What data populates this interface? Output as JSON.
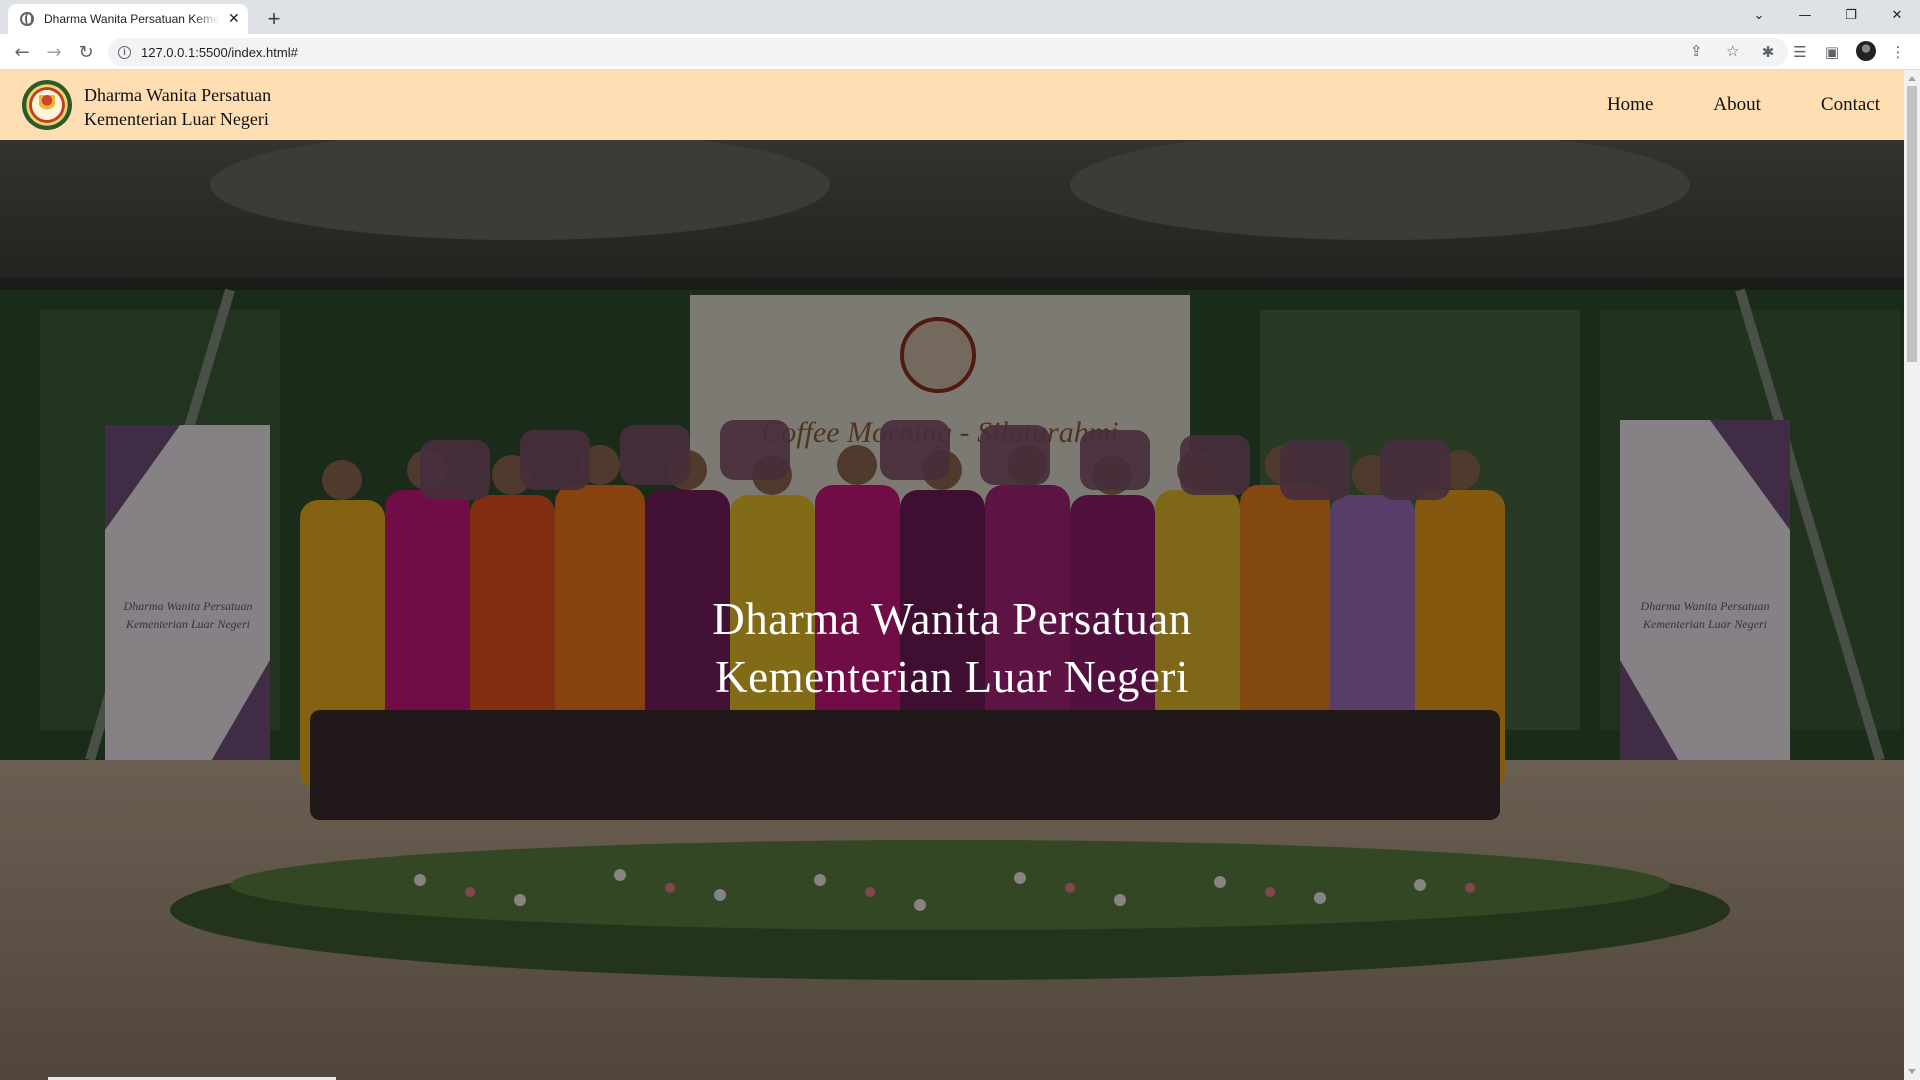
{
  "browser": {
    "tab_title": "Dharma Wanita Persatuan Kementerian Luar Negeri",
    "tab_close": "✕",
    "new_tab": "+",
    "url": "127.0.0.1:5500/index.html#",
    "window_controls": {
      "tabsearch": "⌄",
      "minimize": "—",
      "restore": "❐",
      "close": "✕"
    },
    "icons": [
      "back-icon",
      "forward-icon",
      "reload-icon",
      "info-icon",
      "share-icon",
      "star-icon",
      "extensions-icon",
      "reading-list-icon",
      "side-panel-icon",
      "profile-avatar",
      "menu-icon"
    ]
  },
  "site": {
    "title_line1": "Dharma Wanita Persatuan",
    "title_line2": "Kementerian Luar Negeri",
    "nav": {
      "home": "Home",
      "about": "About",
      "contact": "Contact"
    },
    "header_color": "#ffdeb3"
  },
  "hero": {
    "title_line1": "Dharma Wanita Persatuan",
    "title_line2": "Kementerian Luar Negeri",
    "backdrop_text": "Coffee Morning - Silaturahmi",
    "banner_text_line1": "Dharma Wanita Persatuan",
    "banner_text_line2": "Kementerian Luar Negeri"
  }
}
